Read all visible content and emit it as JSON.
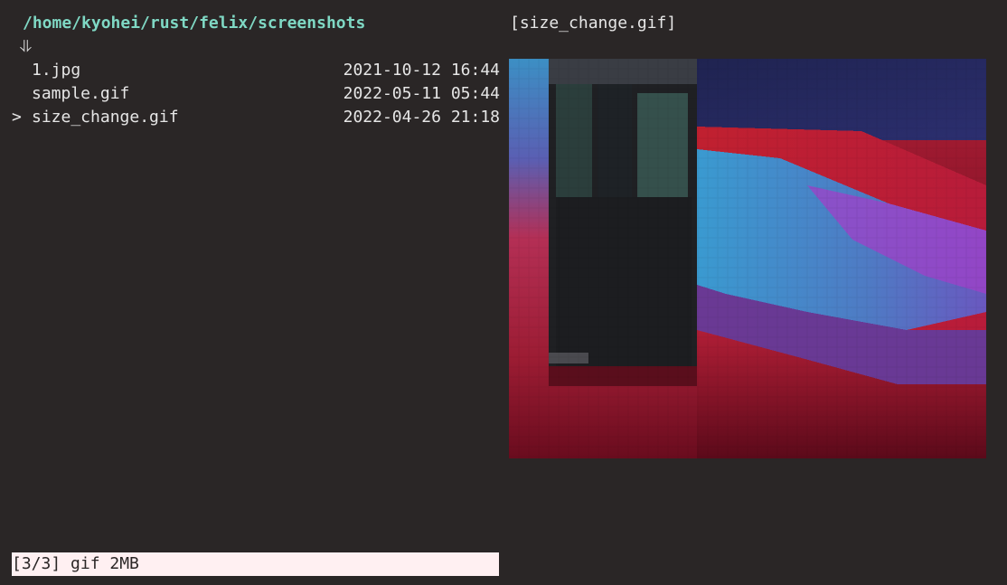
{
  "header": {
    "path": "/home/kyohei/rust/felix/screenshots",
    "sort_indicator": "⥥"
  },
  "files": [
    {
      "cursor": "",
      "name": "1.jpg",
      "modified": "2021-10-12 16:44"
    },
    {
      "cursor": "",
      "name": "sample.gif",
      "modified": "2022-05-11 05:44"
    },
    {
      "cursor": ">",
      "name": "size_change.gif",
      "modified": "2022-04-26 21:18"
    }
  ],
  "preview": {
    "title": "[size_change.gif]"
  },
  "statusbar": {
    "text": "[3/3] gif 2MB"
  },
  "colors": {
    "background": "#2a2626",
    "path": "#7fd8c4",
    "statusbar_bg": "#fff0f2"
  }
}
